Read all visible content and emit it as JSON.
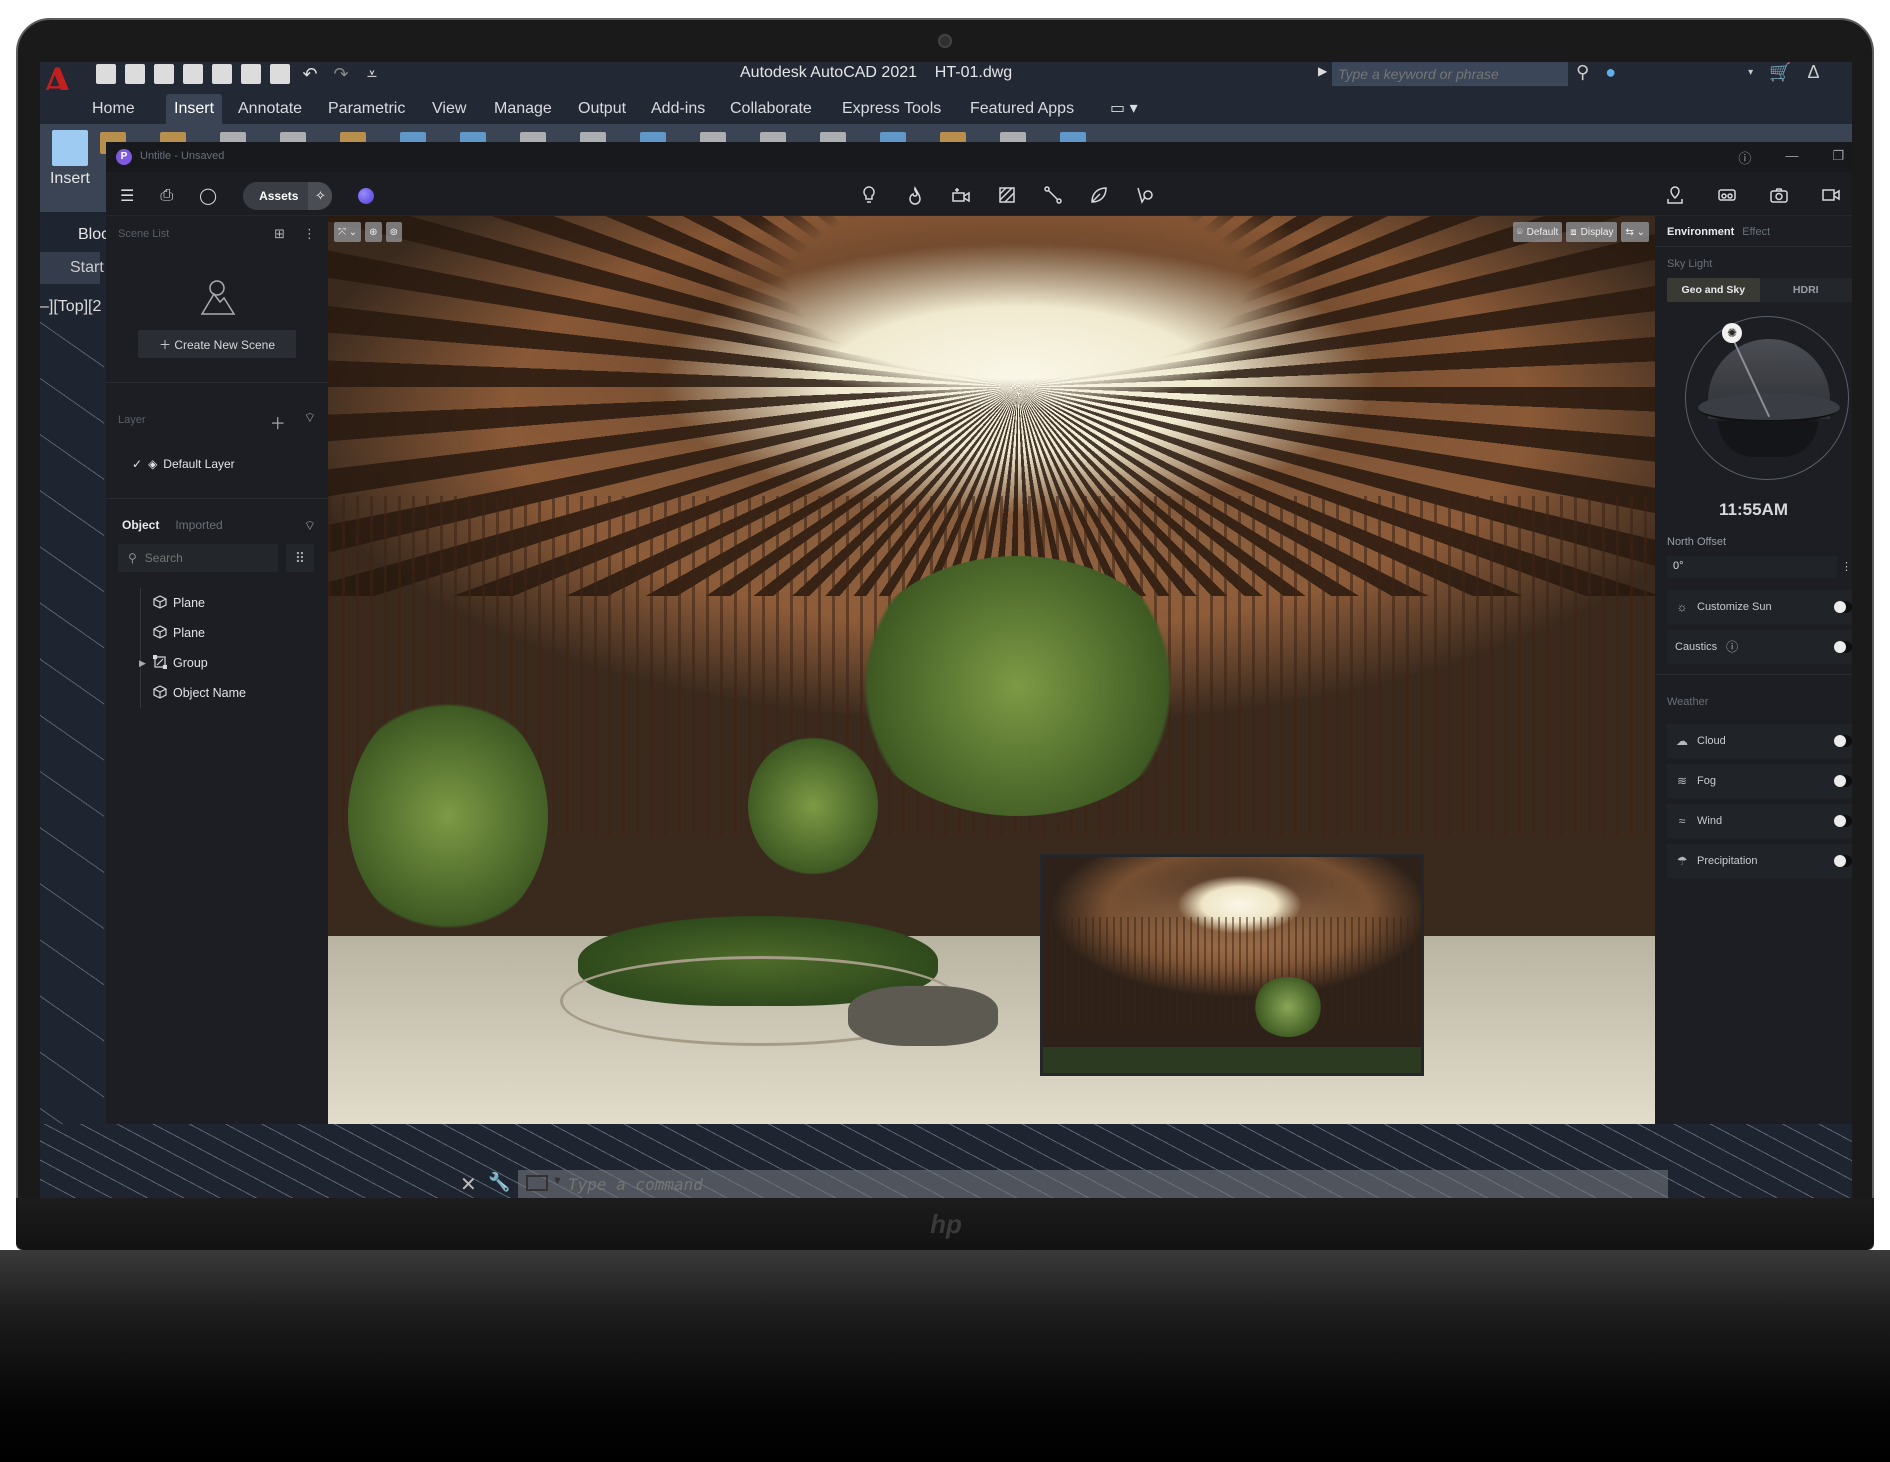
{
  "autocad": {
    "title": "Autodesk AutoCAD 2021",
    "file": "HT-01.dwg",
    "search_placeholder": "Type a keyword or phrase",
    "tabs": [
      "Home",
      "Insert",
      "Annotate",
      "Parametric",
      "View",
      "Manage",
      "Output",
      "Add-ins",
      "Collaborate",
      "Express Tools",
      "Featured Apps"
    ],
    "active_tab": "Insert",
    "ribbon_insert_label": "Insert",
    "block_label": "Bloc",
    "start_tab": "Start",
    "viewport_label": "–][Top][2",
    "command_placeholder": "Type a command"
  },
  "app": {
    "window_title": "Untitle - Unsaved",
    "logo_letter": "P",
    "assets_label": "Assets",
    "center_tools": [
      "light-bulb-icon",
      "fire-icon",
      "add-camera-icon",
      "material-icon",
      "path-icon",
      "leaf-icon",
      "spotlight-icon"
    ],
    "right_tools": [
      "location-icon",
      "vr-headset-icon",
      "camera-icon",
      "video-icon"
    ]
  },
  "left_panel": {
    "scene_list_label": "Scene List",
    "create_scene_label": "Create New Scene",
    "layer_label": "Layer",
    "layers": [
      {
        "name": "Default Layer",
        "checked": true
      }
    ],
    "object_tab": "Object",
    "imported_tab": "Imported",
    "search_placeholder": "Search",
    "objects": [
      {
        "name": "Plane",
        "type": "mesh"
      },
      {
        "name": "Plane",
        "type": "mesh"
      },
      {
        "name": "Group",
        "type": "group",
        "expandable": true
      },
      {
        "name": "Object Name",
        "type": "mesh"
      }
    ]
  },
  "viewport": {
    "camera_preset": "Default",
    "display_label": "Display"
  },
  "right_panel": {
    "tabs": [
      "Environment",
      "Effect"
    ],
    "active_tab": "Environment",
    "sky_light_label": "Sky Light",
    "sky_modes": [
      "Geo and Sky",
      "HDRI"
    ],
    "active_sky_mode": "Geo and Sky",
    "time": "11:55AM",
    "north_offset_label": "North Offset",
    "north_offset_value": "0°",
    "customize_sun_label": "Customize Sun",
    "customize_sun_on": false,
    "caustics_label": "Caustics",
    "caustics_on": false,
    "weather_label": "Weather",
    "weather": [
      {
        "label": "Cloud",
        "icon": "cloud-icon",
        "on": false
      },
      {
        "label": "Fog",
        "icon": "fog-icon",
        "on": false
      },
      {
        "label": "Wind",
        "icon": "wind-icon",
        "on": false
      },
      {
        "label": "Precipitation",
        "icon": "precipitation-icon",
        "on": false
      }
    ]
  },
  "colors": {
    "autocad_bg": "#222834",
    "ribbon_bg": "#3b4455",
    "app_bg": "#17191d",
    "panel_bg": "#1c1e23",
    "accent_purple": "#7f5ae0",
    "autocad_red": "#c21f1f"
  }
}
